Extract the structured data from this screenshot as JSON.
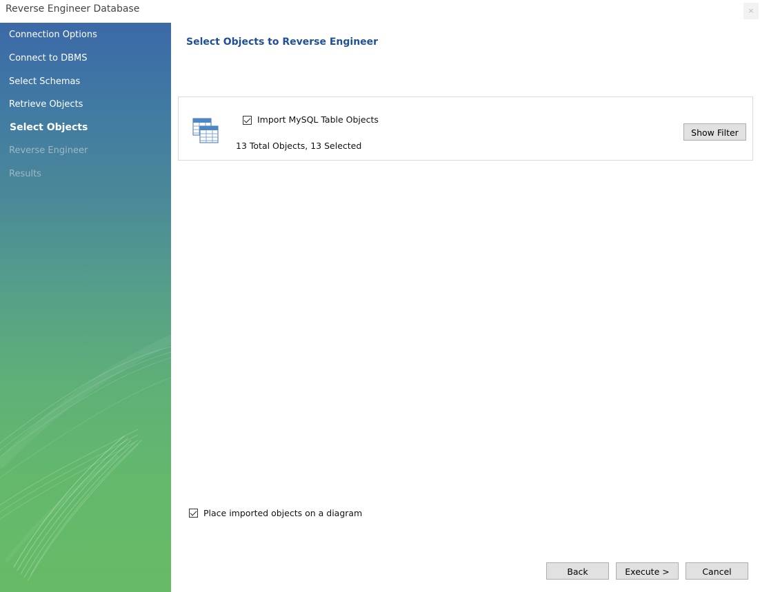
{
  "window": {
    "title": "Reverse Engineer Database",
    "close_glyph": "×"
  },
  "sidebar": {
    "steps": [
      {
        "label": "Connection Options",
        "state": "done"
      },
      {
        "label": "Connect to DBMS",
        "state": "done"
      },
      {
        "label": "Select Schemas",
        "state": "done"
      },
      {
        "label": "Retrieve Objects",
        "state": "done"
      },
      {
        "label": "Select Objects",
        "state": "current"
      },
      {
        "label": "Reverse Engineer",
        "state": "pending"
      },
      {
        "label": "Results",
        "state": "pending"
      }
    ]
  },
  "main": {
    "heading": "Select Objects to Reverse Engineer",
    "objects_panel": {
      "icon": "table-objects-icon",
      "import_checkbox_label": "Import MySQL Table Objects",
      "import_checked": true,
      "summary": "13 Total Objects, 13 Selected",
      "show_filter_label": "Show Filter"
    },
    "place_on_diagram_label": "Place imported objects on a diagram",
    "place_on_diagram_checked": true
  },
  "footer": {
    "back_label": "Back",
    "execute_label": "Execute >",
    "cancel_label": "Cancel"
  }
}
